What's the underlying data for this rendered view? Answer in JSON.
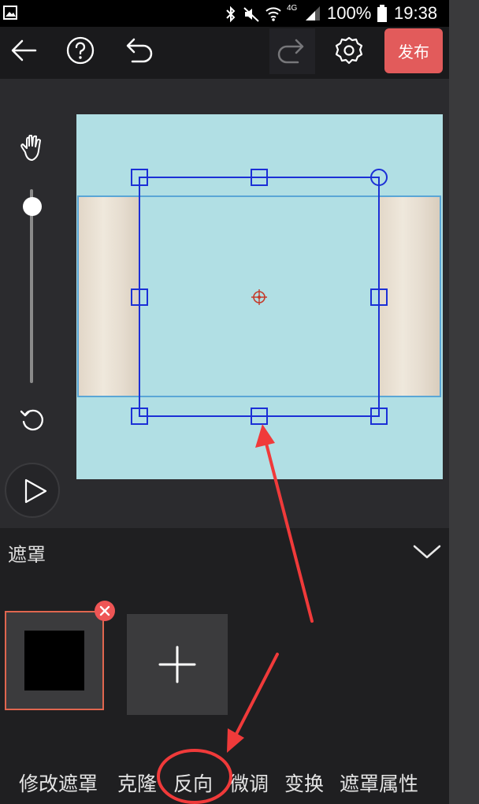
{
  "status_bar": {
    "network": "4G",
    "battery": "100%",
    "time": "19:38"
  },
  "toolbar": {
    "publish_label": "发布",
    "icons": [
      "back-arrow-icon",
      "help-icon",
      "undo-icon",
      "redo-icon",
      "settings-icon"
    ]
  },
  "panel": {
    "title": "遮罩"
  },
  "menu": {
    "items": [
      "修改遮罩",
      "克隆",
      "反向",
      "微调",
      "变换",
      "遮罩属性"
    ]
  },
  "colors": {
    "publish": "#e25b5b",
    "canvas": "#b1dfe4",
    "selection": "#1b2fd6",
    "annotation": "#f03a3a"
  }
}
